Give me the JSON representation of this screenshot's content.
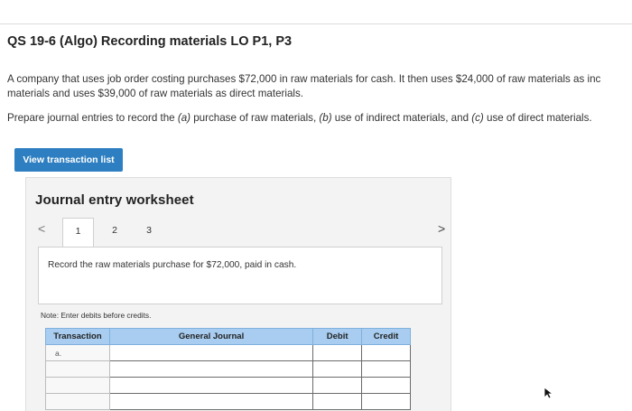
{
  "header": {
    "title": "QS 19-6 (Algo) Recording materials LO P1, P3"
  },
  "problem": {
    "line1": "A company that uses job order costing purchases $72,000 in raw materials for cash. It then uses $24,000 of raw materials as inc",
    "line2": "materials and uses $39,000 of raw materials as direct materials."
  },
  "instructions": {
    "prefix": "Prepare journal entries to record the ",
    "a_marker": "(a)",
    "a_text": " purchase of raw materials, ",
    "b_marker": "(b)",
    "b_text": " use of indirect materials, and ",
    "c_marker": "(c)",
    "c_text": " use of direct materials."
  },
  "view_button_label": "View transaction list",
  "worksheet": {
    "title": "Journal entry worksheet",
    "prev_icon": "<",
    "next_icon": ">",
    "tabs": [
      {
        "label": "1",
        "active": true
      },
      {
        "label": "2",
        "active": false
      },
      {
        "label": "3",
        "active": false
      }
    ],
    "instruction": "Record the raw materials purchase for $72,000, paid in cash.",
    "note": "Note: Enter debits before credits."
  },
  "journal": {
    "columns": [
      "Transaction",
      "General Journal",
      "Debit",
      "Credit"
    ],
    "rows": [
      {
        "transaction": "a.",
        "account": "",
        "debit": "",
        "credit": ""
      },
      {
        "transaction": "",
        "account": "",
        "debit": "",
        "credit": ""
      },
      {
        "transaction": "",
        "account": "",
        "debit": "",
        "credit": ""
      },
      {
        "transaction": "",
        "account": "",
        "debit": "",
        "credit": ""
      }
    ]
  },
  "colors": {
    "button": "#2e7fc1",
    "header_fill": "#a8cdf0",
    "worksheet_bg": "#f3f3f3"
  }
}
